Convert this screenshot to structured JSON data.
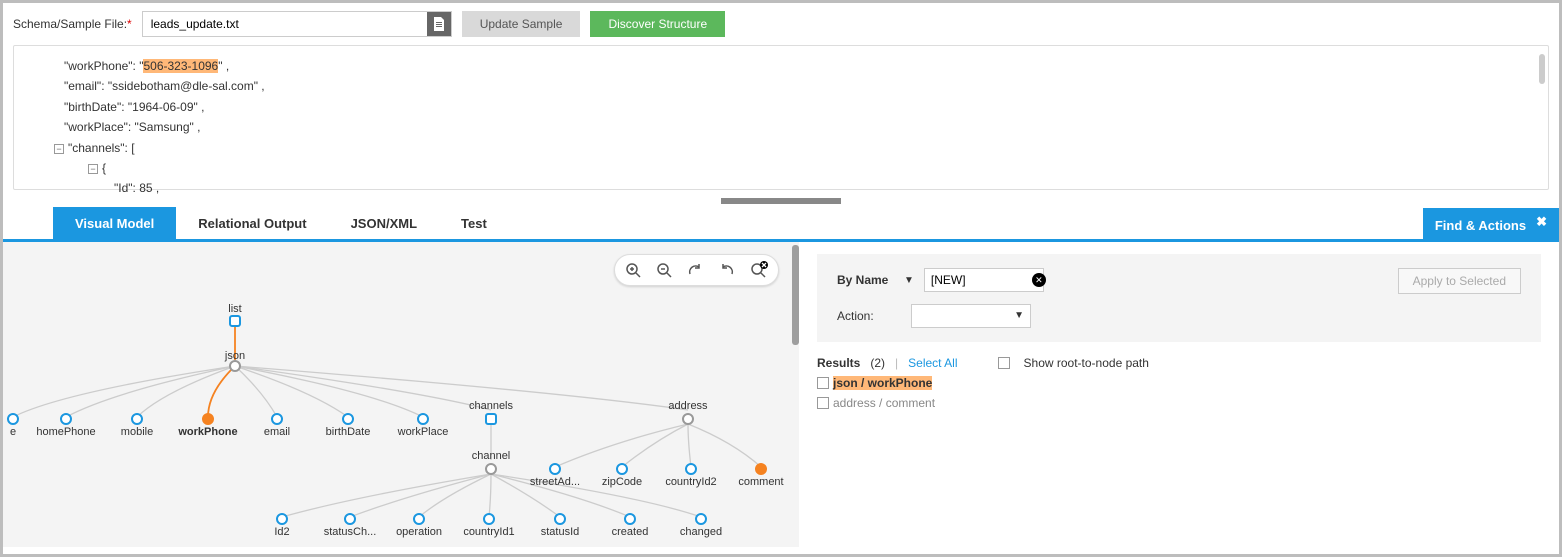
{
  "toolbar": {
    "label": "Schema/Sample File:",
    "filename": "leads_update.txt",
    "update": "Update Sample",
    "discover": "Discover Structure"
  },
  "sample": {
    "l1a": "\"workPhone\": \"",
    "l1b": "506-323-1096",
    "l1c": "\" ,",
    "l2": "\"email\": \"ssidebotham@dle-sal.com\" ,",
    "l3": "\"birthDate\": \"1964-06-09\" ,",
    "l4": "\"workPlace\": \"Samsung\" ,",
    "l5": "\"channels\": [",
    "l6": "{",
    "l7": "\"Id\": 85 ,"
  },
  "tabs": {
    "t1": "Visual Model",
    "t2": "Relational Output",
    "t3": "JSON/XML",
    "t4": "Test",
    "right": "Find & Actions"
  },
  "panel": {
    "byname": "By Name",
    "byname_val": "[NEW]",
    "action": "Action:",
    "apply": "Apply to Selected",
    "results": "Results",
    "count": "(2)",
    "sep": "|",
    "selall": "Select All",
    "showpath": "Show root-to-node path",
    "r1": "json / workPhone",
    "r2": "address / comment"
  },
  "nodes": {
    "list": "list",
    "json": "json",
    "e": "e",
    "homePhone": "homePhone",
    "mobile": "mobile",
    "workPhone": "workPhone",
    "email": "email",
    "birthDate": "birthDate",
    "workPlace": "workPlace",
    "channels": "channels",
    "address": "address",
    "channel": "channel",
    "streetAd": "streetAd...",
    "zipCode": "zipCode",
    "countryId2": "countryId2",
    "comment": "comment",
    "Id2": "Id2",
    "statusCh": "statusCh...",
    "operation": "operation",
    "countryId1": "countryId1",
    "statusId": "statusId",
    "created": "created",
    "changed": "changed"
  }
}
